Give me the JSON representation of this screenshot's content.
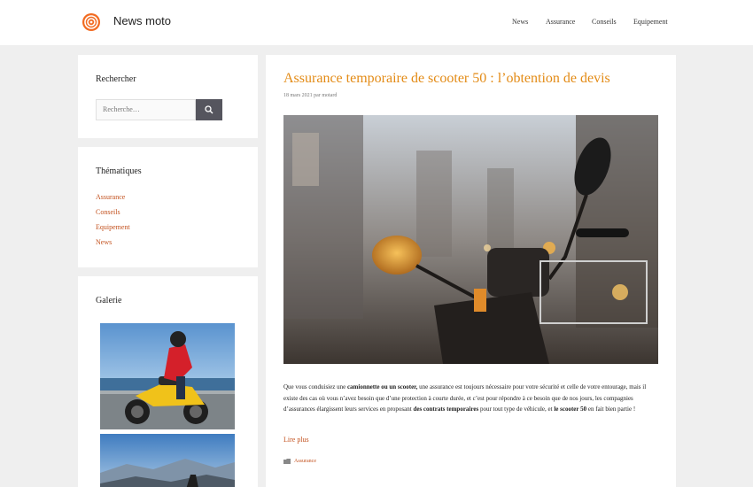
{
  "header": {
    "brand": "News moto",
    "nav": [
      "News",
      "Assurance",
      "Conseils",
      "Equipement"
    ]
  },
  "sidebar": {
    "search": {
      "title": "Rechercher",
      "placeholder": "Recherche…",
      "icon": "search-icon"
    },
    "categories": {
      "title": "Thématiques",
      "items": [
        "Assurance",
        "Conseils",
        "Equipement",
        "News"
      ]
    },
    "gallery": {
      "title": "Galerie"
    }
  },
  "post": {
    "title": "Assurance temporaire de scooter 50 : l’obtention de devis",
    "meta": "18 mars 2021 par motard",
    "excerpt": {
      "p1": "Que vous conduisiez une ",
      "b1": "camionnette ou un scooter,",
      "p2": " une assurance est toujours nécessaire pour votre sécurité et celle de votre entourage, mais il existe des cas où vous n’avez besoin que d’une protection à courte durée, et c’est pour répondre à ce besoin que de nos jours, les compagnies d’assurances élargissent leurs services en proposant ",
      "b2": "des contrats temporaires",
      "p3": " pour tout type de véhicule, et ",
      "b3": "le scooter 50",
      "p4": " en fait bien partie !"
    },
    "read_more": "Lire plus",
    "category": "Assurance"
  },
  "colors": {
    "accent": "#e38b16",
    "link": "#c3521f",
    "search_button": "#55555e"
  }
}
